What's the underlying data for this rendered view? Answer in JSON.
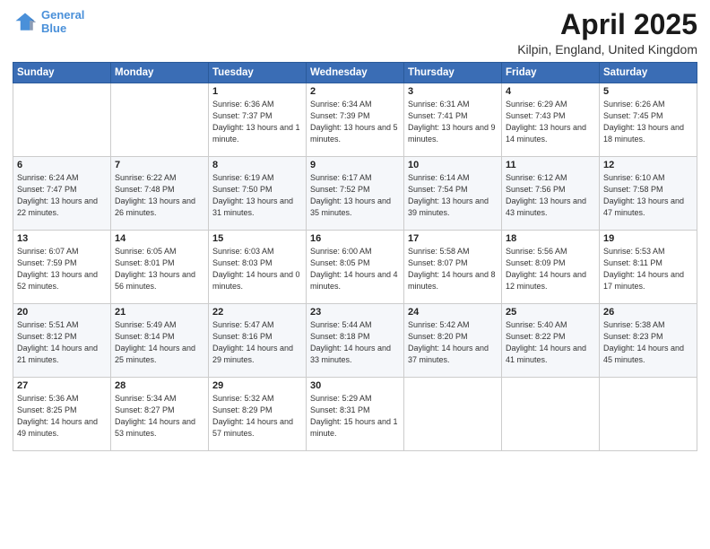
{
  "header": {
    "logo_line1": "General",
    "logo_line2": "Blue",
    "title": "April 2025",
    "subtitle": "Kilpin, England, United Kingdom"
  },
  "days_of_week": [
    "Sunday",
    "Monday",
    "Tuesday",
    "Wednesday",
    "Thursday",
    "Friday",
    "Saturday"
  ],
  "weeks": [
    [
      {
        "day": "",
        "info": ""
      },
      {
        "day": "",
        "info": ""
      },
      {
        "day": "1",
        "info": "Sunrise: 6:36 AM\nSunset: 7:37 PM\nDaylight: 13 hours and 1 minute."
      },
      {
        "day": "2",
        "info": "Sunrise: 6:34 AM\nSunset: 7:39 PM\nDaylight: 13 hours and 5 minutes."
      },
      {
        "day": "3",
        "info": "Sunrise: 6:31 AM\nSunset: 7:41 PM\nDaylight: 13 hours and 9 minutes."
      },
      {
        "day": "4",
        "info": "Sunrise: 6:29 AM\nSunset: 7:43 PM\nDaylight: 13 hours and 14 minutes."
      },
      {
        "day": "5",
        "info": "Sunrise: 6:26 AM\nSunset: 7:45 PM\nDaylight: 13 hours and 18 minutes."
      }
    ],
    [
      {
        "day": "6",
        "info": "Sunrise: 6:24 AM\nSunset: 7:47 PM\nDaylight: 13 hours and 22 minutes."
      },
      {
        "day": "7",
        "info": "Sunrise: 6:22 AM\nSunset: 7:48 PM\nDaylight: 13 hours and 26 minutes."
      },
      {
        "day": "8",
        "info": "Sunrise: 6:19 AM\nSunset: 7:50 PM\nDaylight: 13 hours and 31 minutes."
      },
      {
        "day": "9",
        "info": "Sunrise: 6:17 AM\nSunset: 7:52 PM\nDaylight: 13 hours and 35 minutes."
      },
      {
        "day": "10",
        "info": "Sunrise: 6:14 AM\nSunset: 7:54 PM\nDaylight: 13 hours and 39 minutes."
      },
      {
        "day": "11",
        "info": "Sunrise: 6:12 AM\nSunset: 7:56 PM\nDaylight: 13 hours and 43 minutes."
      },
      {
        "day": "12",
        "info": "Sunrise: 6:10 AM\nSunset: 7:58 PM\nDaylight: 13 hours and 47 minutes."
      }
    ],
    [
      {
        "day": "13",
        "info": "Sunrise: 6:07 AM\nSunset: 7:59 PM\nDaylight: 13 hours and 52 minutes."
      },
      {
        "day": "14",
        "info": "Sunrise: 6:05 AM\nSunset: 8:01 PM\nDaylight: 13 hours and 56 minutes."
      },
      {
        "day": "15",
        "info": "Sunrise: 6:03 AM\nSunset: 8:03 PM\nDaylight: 14 hours and 0 minutes."
      },
      {
        "day": "16",
        "info": "Sunrise: 6:00 AM\nSunset: 8:05 PM\nDaylight: 14 hours and 4 minutes."
      },
      {
        "day": "17",
        "info": "Sunrise: 5:58 AM\nSunset: 8:07 PM\nDaylight: 14 hours and 8 minutes."
      },
      {
        "day": "18",
        "info": "Sunrise: 5:56 AM\nSunset: 8:09 PM\nDaylight: 14 hours and 12 minutes."
      },
      {
        "day": "19",
        "info": "Sunrise: 5:53 AM\nSunset: 8:11 PM\nDaylight: 14 hours and 17 minutes."
      }
    ],
    [
      {
        "day": "20",
        "info": "Sunrise: 5:51 AM\nSunset: 8:12 PM\nDaylight: 14 hours and 21 minutes."
      },
      {
        "day": "21",
        "info": "Sunrise: 5:49 AM\nSunset: 8:14 PM\nDaylight: 14 hours and 25 minutes."
      },
      {
        "day": "22",
        "info": "Sunrise: 5:47 AM\nSunset: 8:16 PM\nDaylight: 14 hours and 29 minutes."
      },
      {
        "day": "23",
        "info": "Sunrise: 5:44 AM\nSunset: 8:18 PM\nDaylight: 14 hours and 33 minutes."
      },
      {
        "day": "24",
        "info": "Sunrise: 5:42 AM\nSunset: 8:20 PM\nDaylight: 14 hours and 37 minutes."
      },
      {
        "day": "25",
        "info": "Sunrise: 5:40 AM\nSunset: 8:22 PM\nDaylight: 14 hours and 41 minutes."
      },
      {
        "day": "26",
        "info": "Sunrise: 5:38 AM\nSunset: 8:23 PM\nDaylight: 14 hours and 45 minutes."
      }
    ],
    [
      {
        "day": "27",
        "info": "Sunrise: 5:36 AM\nSunset: 8:25 PM\nDaylight: 14 hours and 49 minutes."
      },
      {
        "day": "28",
        "info": "Sunrise: 5:34 AM\nSunset: 8:27 PM\nDaylight: 14 hours and 53 minutes."
      },
      {
        "day": "29",
        "info": "Sunrise: 5:32 AM\nSunset: 8:29 PM\nDaylight: 14 hours and 57 minutes."
      },
      {
        "day": "30",
        "info": "Sunrise: 5:29 AM\nSunset: 8:31 PM\nDaylight: 15 hours and 1 minute."
      },
      {
        "day": "",
        "info": ""
      },
      {
        "day": "",
        "info": ""
      },
      {
        "day": "",
        "info": ""
      }
    ]
  ]
}
